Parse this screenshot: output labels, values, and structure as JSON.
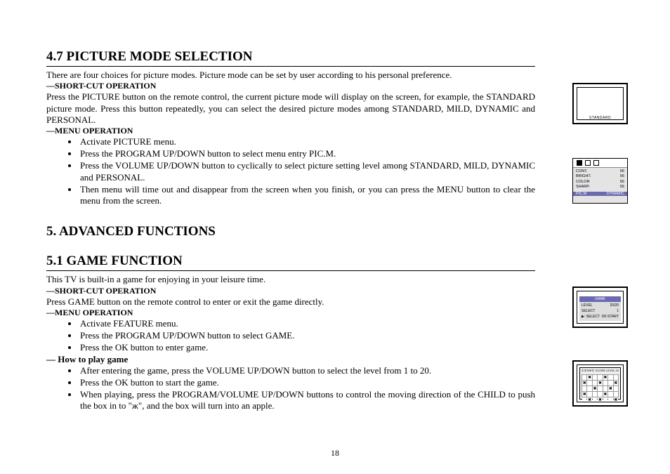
{
  "page_number": "18",
  "section47": {
    "title": "4.7 PICTURE MODE SELECTION",
    "intro": "There are four choices for picture modes. Picture mode can be set by user according to his personal preference.",
    "shortcut_label": "—SHORT-CUT OPERATION",
    "shortcut_text": "Press the PICTURE button on the remote control, the current picture mode will display on the screen, for example, the STANDARD picture mode. Press this button repeatedly, you can select the desired picture modes among STANDARD, MILD, DYNAMIC and PERSONAL.",
    "menuop_label": "—MENU OPERATION",
    "bullets": [
      "Activate PICTURE menu.",
      "Press the PROGRAM UP/DOWN button to select menu entry PIC.M.",
      "Press the VOLUME UP/DOWN button to cyclically to select picture setting level among STANDARD, MILD, DYNAMIC and PERSONAL.",
      "Then menu will time out and disappear from the screen when you finish, or you can press the MENU button to clear the menu from the screen."
    ]
  },
  "section5": {
    "title": "5.   ADVANCED FUNCTIONS"
  },
  "section51": {
    "title": "5.1 GAME FUNCTION",
    "intro": "This TV is built-in a game for enjoying in your leisure time.",
    "shortcut_label": "—SHORT-CUT OPERATION",
    "shortcut_text": "Press GAME button on the remote control to enter or exit the game directly.",
    "menuop_label": "—MENU OPERATION",
    "menu_bullets": [
      "Activate FEATURE menu.",
      "Press the PROGRAM UP/DOWN button to select GAME.",
      "Press the OK button to enter game."
    ],
    "howto_label": "— How to play game",
    "howto_bullets": [
      "After entering the game, press the VOLUME UP/DOWN button to select the level from 1 to 20.",
      "Press the OK button to start the game.",
      "When playing, press the PROGRAM/VOLUME UP/DOWN buttons to control the moving direction of the CHILD to push the box in to \"ж\", and the box will turn into an apple."
    ]
  },
  "illus1": {
    "label": "STANDARD"
  },
  "illus2": {
    "rows": [
      {
        "k": "CONT.",
        "v": "56"
      },
      {
        "k": "BRIGHT.",
        "v": "56"
      },
      {
        "k": "COLOR",
        "v": "56"
      },
      {
        "k": "SHARP.",
        "v": "56"
      }
    ],
    "bot_l": "PIC.M",
    "bot_r": "DYNAMIC"
  },
  "illus3": {
    "title": "GAME",
    "r1k": "LEVEL",
    "r1v": "20/20",
    "r2k": "SELECT",
    "r2v": "1",
    "r3k": "▶: SELECT",
    "r3v": "OK:START"
  },
  "illus4": {
    "top_l": "①②③④⑤",
    "top_r": "SCORE   LEVEL 20"
  }
}
